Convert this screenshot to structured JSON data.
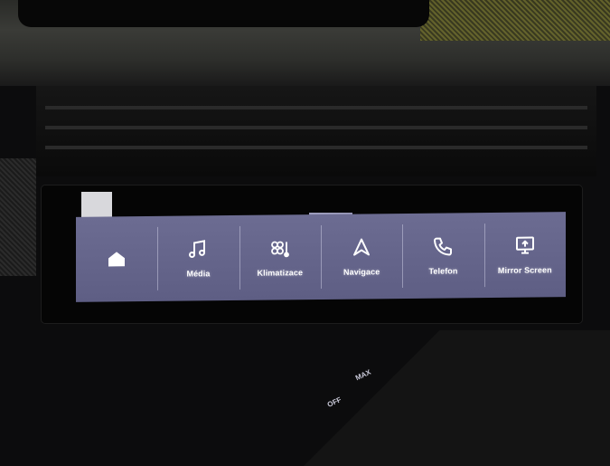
{
  "touchbar": {
    "colors": {
      "bar": "#6c6c92",
      "text": "#ffffff"
    },
    "page_indicator": {
      "pages": 2,
      "current": 1
    },
    "items": [
      {
        "id": "home",
        "label": "",
        "icon": "home-icon"
      },
      {
        "id": "media",
        "label": "Média",
        "icon": "music-note-icon"
      },
      {
        "id": "climate",
        "label": "Klimatizace",
        "icon": "fan-temperature-icon"
      },
      {
        "id": "nav",
        "label": "Navigace",
        "icon": "navigation-arrow-icon"
      },
      {
        "id": "phone",
        "label": "Telefon",
        "icon": "phone-icon"
      },
      {
        "id": "mirror",
        "label": "Mirror Screen",
        "icon": "mirror-screen-icon"
      }
    ]
  },
  "console": {
    "max_button": "MAX",
    "off_button": "OFF"
  }
}
